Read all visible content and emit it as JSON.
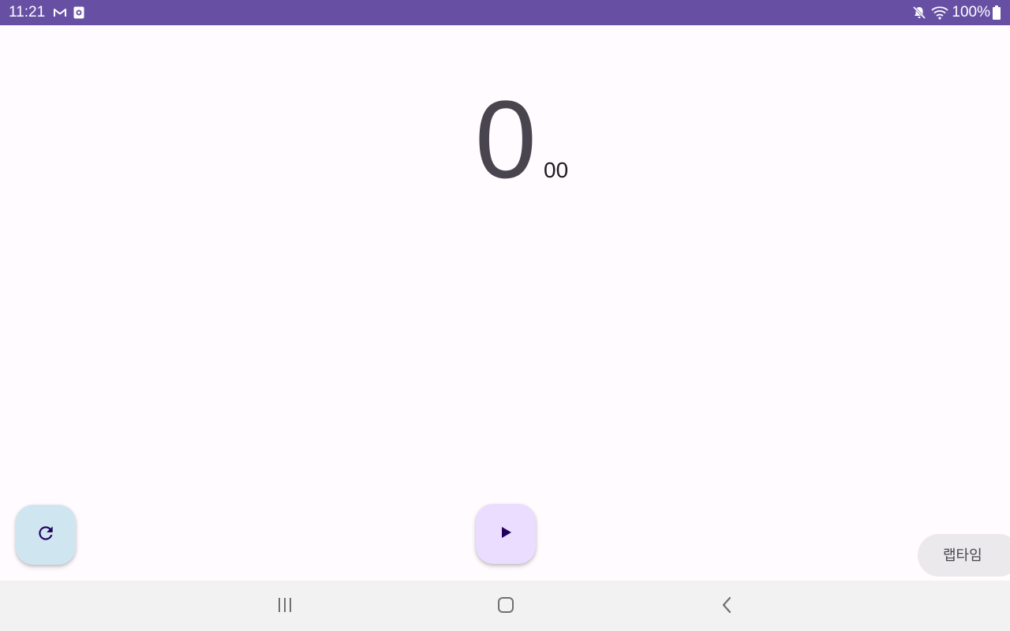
{
  "status_bar": {
    "time": "11:21",
    "battery": "100%",
    "icons": [
      "gmail-icon",
      "app-notification-icon",
      "mute-icon",
      "wifi-icon",
      "battery-icon"
    ],
    "background": "#6750a4"
  },
  "stopwatch": {
    "seconds": "0",
    "centiseconds": "00"
  },
  "controls": {
    "reset_icon": "reset-icon",
    "play_icon": "play-icon",
    "lap_label": "랩타임"
  },
  "nav_bar": {
    "icons": [
      "recent-apps-icon",
      "home-icon",
      "back-icon"
    ]
  },
  "colors": {
    "accent": "#6750a4",
    "reset_fab": "#cfe6f1",
    "play_fab": "#eaddff",
    "icon_dark": "#21005d"
  }
}
